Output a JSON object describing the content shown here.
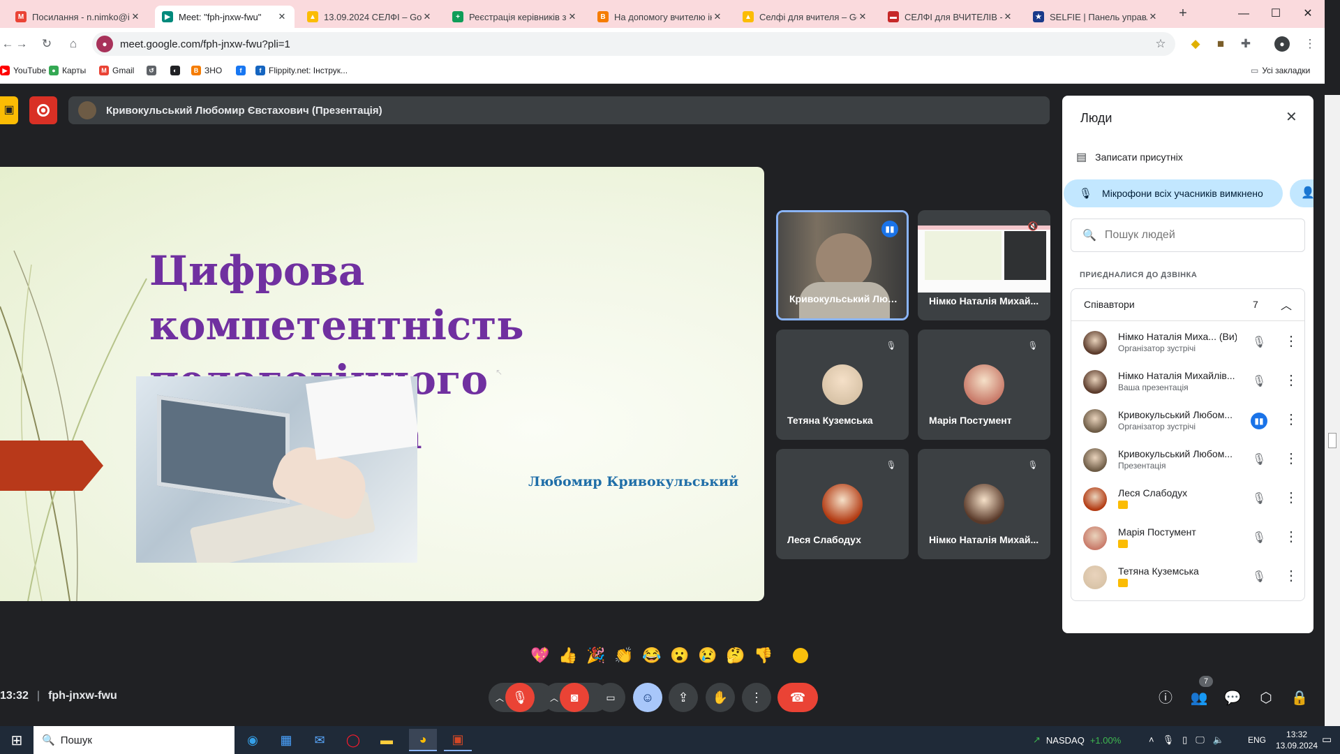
{
  "browser": {
    "tabs": [
      {
        "title": "Посилання - n.nimko@ip",
        "fav": "M",
        "color": "#ea4335"
      },
      {
        "title": "Meet: \"fph-jnxw-fwu\"",
        "fav": "▶",
        "color": "#00897b"
      },
      {
        "title": "13.09.2024 СЕЛФІ – Goog",
        "fav": "▲",
        "color": "#fbbc04"
      },
      {
        "title": "Реєстрація керівників за",
        "fav": "+",
        "color": "#0f9d58"
      },
      {
        "title": "На допомогу вчителю ін",
        "fav": "B",
        "color": "#f57c00"
      },
      {
        "title": "Селфі для вчителя – Goo",
        "fav": "▲",
        "color": "#fbbc04"
      },
      {
        "title": "СЕЛФІ для ВЧИТЕЛІВ - Є",
        "fav": "▬",
        "color": "#c62828"
      },
      {
        "title": "SELFIE | Панель управлін",
        "fav": "★",
        "color": "#1a3a8a"
      }
    ],
    "active_tab": 1,
    "new_tab": "+",
    "url": "meet.google.com/fph-jnxw-fwu?pli=1",
    "bookmarks": [
      {
        "label": "YouTube",
        "color": "#ff0000",
        "ic": "▶"
      },
      {
        "label": "Карты",
        "color": "#34a853",
        "ic": "●"
      },
      {
        "label": "Gmail",
        "color": "#ea4335",
        "ic": "M"
      },
      {
        "label": "",
        "color": "#5f6368",
        "ic": "↺"
      },
      {
        "label": "",
        "color": "#202124",
        "ic": "◐"
      },
      {
        "label": "ЗНО",
        "color": "#f57c00",
        "ic": "B"
      },
      {
        "label": "",
        "color": "#1877f2",
        "ic": "f"
      },
      {
        "label": "Flippity.net: Інструк...",
        "color": "#1565c0",
        "ic": "f"
      }
    ],
    "all_bookmarks": "Усі закладки"
  },
  "meet": {
    "presenter_bar": "Кривокульський Любомир Євстахович (Презентація)",
    "slide": {
      "title_line1": "Цифрова компетентність",
      "title_line2": "педагогічного працівника",
      "author": "Любомир Кривокульський"
    },
    "tiles": [
      {
        "name": "Кривокульський Люб...",
        "kind": "video",
        "speaking": true
      },
      {
        "name": "Німко Наталія Михай...",
        "kind": "screen",
        "muted": true
      },
      {
        "name": "Тетяна Куземська",
        "kind": "avatar",
        "color": "#d9c4a8",
        "muted": true
      },
      {
        "name": "Марія Постумент",
        "kind": "avatar",
        "color": "#c97b6a",
        "muted": true
      },
      {
        "name": "Леся Слабодух",
        "kind": "avatar",
        "color": "#b23a12",
        "muted": true
      },
      {
        "name": "Німко Наталія Михай...",
        "kind": "avatar",
        "color": "#5a3a2a",
        "muted": true
      }
    ],
    "reactions": [
      "💖",
      "👍",
      "🎉",
      "👏",
      "😂",
      "😮",
      "😢",
      "🤔",
      "👎"
    ],
    "meeting_time": "13:32",
    "meeting_code": "fph-jnxw-fwu",
    "people_count": "7"
  },
  "people_panel": {
    "title": "Люди",
    "record_attendance": "Записати присутніх",
    "mute_all": "Мікрофони всіх учасників вимкнено",
    "search_placeholder": "Пошук людей",
    "section": "ПРИЄДНАЛИСЯ ДО ДЗВІНКА",
    "group": "Співавтори",
    "group_count": "7",
    "participants": [
      {
        "name": "Німко Наталія Миха... (Ви)",
        "sub": "Організатор зустрічі",
        "color": "#5a3a2a",
        "mic": "off"
      },
      {
        "name": "Німко Наталія Михайлів...",
        "sub": "Ваша презентація",
        "color": "#5a3a2a",
        "mic": "off"
      },
      {
        "name": "Кривокульський Любом...",
        "sub": "Організатор зустрічі",
        "color": "#6d5b45",
        "mic": "on"
      },
      {
        "name": "Кривокульський Любом...",
        "sub": "Презентація",
        "color": "#6d5b45",
        "mic": "off"
      },
      {
        "name": "Леся Слабодух",
        "sub": "",
        "color": "#b23a12",
        "mic": "off"
      },
      {
        "name": "Марія Постумент",
        "sub": "",
        "color": "#c97b6a",
        "mic": "off"
      },
      {
        "name": "Тетяна Куземська",
        "sub": "",
        "color": "#d9c4a8",
        "mic": "off"
      }
    ]
  },
  "taskbar": {
    "search": "Пошук",
    "stock": "NASDAQ",
    "stock_change": "+1.00%",
    "lang": "ENG",
    "time": "13:32",
    "date": "13.09.2024"
  }
}
